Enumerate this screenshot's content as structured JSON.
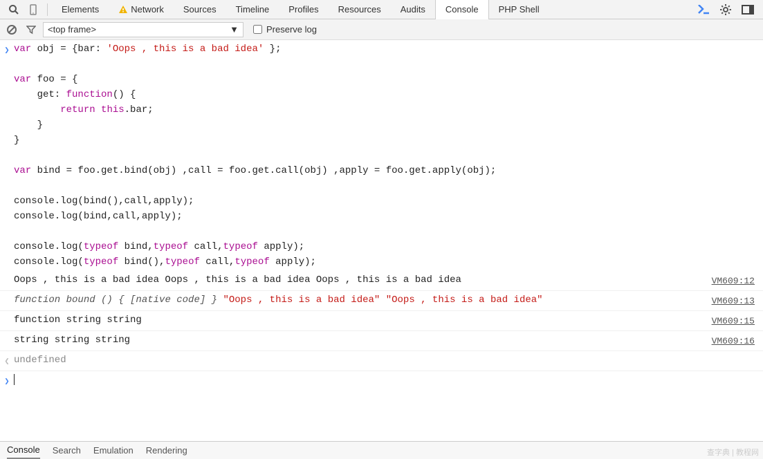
{
  "tabs": [
    "Elements",
    "Network",
    "Sources",
    "Timeline",
    "Profiles",
    "Resources",
    "Audits",
    "Console",
    "PHP Shell"
  ],
  "activeTab": "Console",
  "frameSelect": "<top frame>",
  "preserveLog": "Preserve log",
  "code": {
    "l1a": "var",
    "l1b": " obj = {bar: ",
    "l1c": "'Oops , this is a bad idea'",
    "l1d": " };",
    "l2a": "var",
    "l2b": " foo = {",
    "l3a": "    get: ",
    "l3b": "function",
    "l3c": "() {",
    "l4a": "        ",
    "l4b": "return",
    "l4c": " ",
    "l4d": "this",
    "l4e": ".bar;",
    "l5": "    }",
    "l6": "}",
    "l7a": "var",
    "l7b": " bind = foo.get.bind(obj) ,call = foo.get.call(obj) ,apply = foo.get.apply(obj);",
    "l8": "console.log(bind(),call,apply);",
    "l9": "console.log(bind,call,apply);",
    "l10a": "console.log(",
    "l10b": "typeof",
    "l10c": " bind,",
    "l10d": "typeof",
    "l10e": " call,",
    "l10f": "typeof",
    "l10g": " apply);",
    "l11a": "console.log(",
    "l11b": "typeof",
    "l11c": " bind(),",
    "l11d": "typeof",
    "l11e": " call,",
    "l11f": "typeof",
    "l11g": " apply);"
  },
  "out": [
    {
      "text": "Oops , this is a bad idea Oops , this is a bad idea Oops , this is a bad idea",
      "src": "VM609:12"
    },
    {
      "fnpart": "function",
      "itpart": " bound () { [native code] } ",
      "s1": "\"Oops , this is a bad idea\"",
      "mid": " ",
      "s2": "\"Oops , this is a bad idea\"",
      "src": "VM609:13"
    },
    {
      "text": "function string string",
      "src": "VM609:15"
    },
    {
      "text": "string string string",
      "src": "VM609:16"
    }
  ],
  "returnVal": "undefined",
  "statusTabs": [
    "Console",
    "Search",
    "Emulation",
    "Rendering"
  ],
  "watermark": "查字典 | 教程网"
}
